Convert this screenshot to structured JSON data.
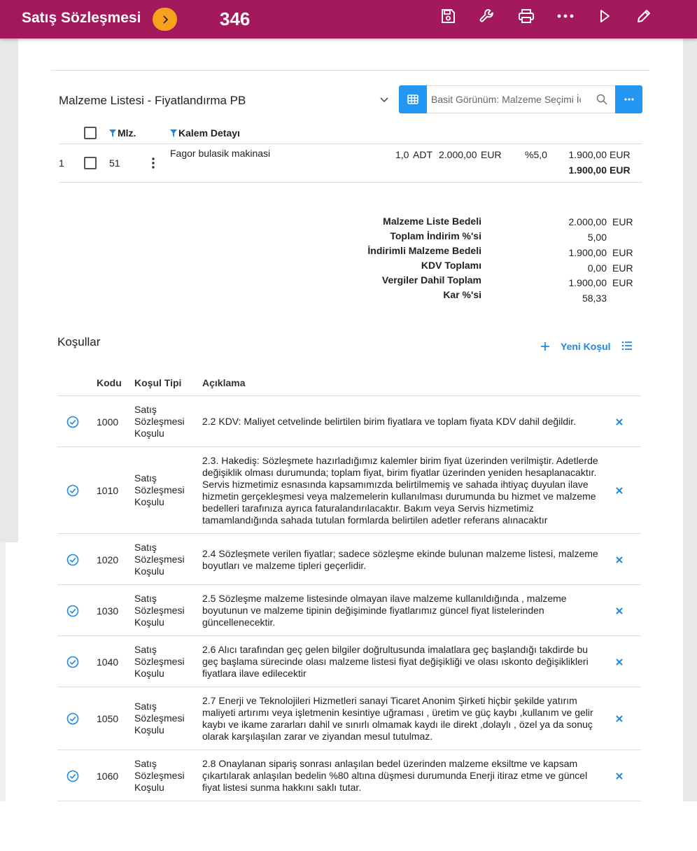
{
  "header": {
    "title": "Satış Sözleşmesi",
    "record_no": "346"
  },
  "materials": {
    "title": "Malzeme Listesi - Fiyatlandırma PB",
    "search_placeholder": "Basit Görünüm: Malzeme Seçimi İç",
    "col_mlz": "Mlz.",
    "col_detail": "Kalem Detayı",
    "rows": [
      {
        "index": "1",
        "mlz": "51",
        "detail": "Fagor bulasik makinasi",
        "qty": "1,0",
        "unit": "ADT",
        "price": "2.000,00",
        "price_cur": "EUR",
        "discount": "%5,0",
        "net": "1.900,00",
        "net_cur": "EUR",
        "total": "1.900,00",
        "total_cur": "EUR"
      }
    ]
  },
  "summary": [
    {
      "label": "Malzeme Liste Bedeli",
      "value": "2.000,00",
      "cur": "EUR"
    },
    {
      "label": "Toplam İndirim %'si",
      "value": "5,00",
      "cur": ""
    },
    {
      "label": "İndirimli Malzeme Bedeli",
      "value": "1.900,00",
      "cur": "EUR"
    },
    {
      "label": "KDV Toplamı",
      "value": "0,00",
      "cur": "EUR"
    },
    {
      "label": "Vergiler Dahil Toplam",
      "value": "1.900,00",
      "cur": "EUR"
    },
    {
      "label": "Kar %'si",
      "value": "58,33",
      "cur": ""
    }
  ],
  "conditions": {
    "title": "Koşullar",
    "new_label": "Yeni Koşul",
    "col_code": "Kodu",
    "col_type": "Koşul Tipi",
    "col_desc": "Açıklama",
    "rows": [
      {
        "code": "1000",
        "type": [
          "Satış",
          "Sözleşmesi",
          "Koşulu"
        ],
        "desc": "2.2 KDV: Maliyet cetvelinde belirtilen birim fiyatlara ve toplam fiyata KDV dahil değildir."
      },
      {
        "code": "1010",
        "type": [
          "Satış",
          "Sözleşmesi",
          "Koşulu"
        ],
        "desc": "2.3. Hakediş: Sözleşmete hazırladığımız kalemler birim fiyat üzerinden verilmiştir. Adetlerde değişiklik olması durumunda; toplam fiyat, birim fiyatlar üzerinden yeniden hesaplanacaktır. Servis hizmetimiz esnasında kapsamımızda belirtilmemiş ve sahada ihtiyaç duyulan ilave hizmetin gerçekleşmesi veya malzemelerin kullanılması durumunda bu hizmet ve malzeme bedelleri tarafınıza ayrıca faturalandırılacaktır. Bakım veya Servis hizmetimiz tamamlandığında sahada tutulan formlarda belirtilen adetler referans alınacaktır"
      },
      {
        "code": "1020",
        "type": [
          "Satış",
          "Sözleşmesi",
          "Koşulu"
        ],
        "desc": "2.4 Sözleşmete verilen fiyatlar; sadece sözleşme ekinde bulunan malzeme listesi, malzeme boyutları ve malzeme tipleri geçerlidir."
      },
      {
        "code": "1030",
        "type": [
          "Satış",
          "Sözleşmesi",
          "Koşulu"
        ],
        "desc": "2.5 Sözleşme malzeme listesinde olmayan ilave malzeme kullanıldığında , malzeme boyutunun ve malzeme tipinin değişiminde fiyatlarımız güncel fiyat listelerinden güncellenecektir."
      },
      {
        "code": "1040",
        "type": [
          "Satış",
          "Sözleşmesi",
          "Koşulu"
        ],
        "desc": "2.6 Alıcı tarafından geç gelen bilgiler doğrultusunda imalatlara geç başlandığı takdirde bu geç başlama sürecinde olası malzeme listesi fiyat değişikliği ve olası ıskonto değişiklikleri fiyatlara ilave edilecektir"
      },
      {
        "code": "1050",
        "type": [
          "Satış",
          "Sözleşmesi",
          "Koşulu"
        ],
        "desc": "2.7 Enerji ve Teknolojileri Hizmetleri sanayi Ticaret Anonim Şirketi hiçbir şekilde yatırım maliyeti artırımı veya işletmenin kesintiye uğraması , üretim ve güç kaybı ,kullanım ve gelir kaybı ve ikame zararları dahil ve sınırlı olmamak kaydı ile direkt ,dolaylı , özel ya da sonuç olarak karşılaşılan zarar ve ziyandan mesul tutulmaz."
      },
      {
        "code": "1060",
        "type": [
          "Satış",
          "Sözleşmesi",
          "Koşulu"
        ],
        "desc": "2.8 Onaylanan sipariş sonrası anlaşılan bedel üzerinden malzeme eksiltme ve kapsam çıkartılarak anlaşılan bedelin %80 altına düşmesi durumunda Enerji itiraz etme ve güncel fiyat listesi sunma hakkını saklı tutar."
      }
    ]
  },
  "colors": {
    "topbar": "#a3195b",
    "nav_button": "#f6a21d",
    "accent_blue": "#2196f3"
  },
  "icons": [
    "chevron-right-icon",
    "save-icon",
    "wrench-icon",
    "print-icon",
    "more-horizontal-icon",
    "play-icon",
    "pencil-icon",
    "chevron-down-icon",
    "grid-icon",
    "search-icon",
    "filter-icon",
    "kebab-icon",
    "plus-icon",
    "list-icon",
    "check-circle-icon",
    "close-icon"
  ]
}
